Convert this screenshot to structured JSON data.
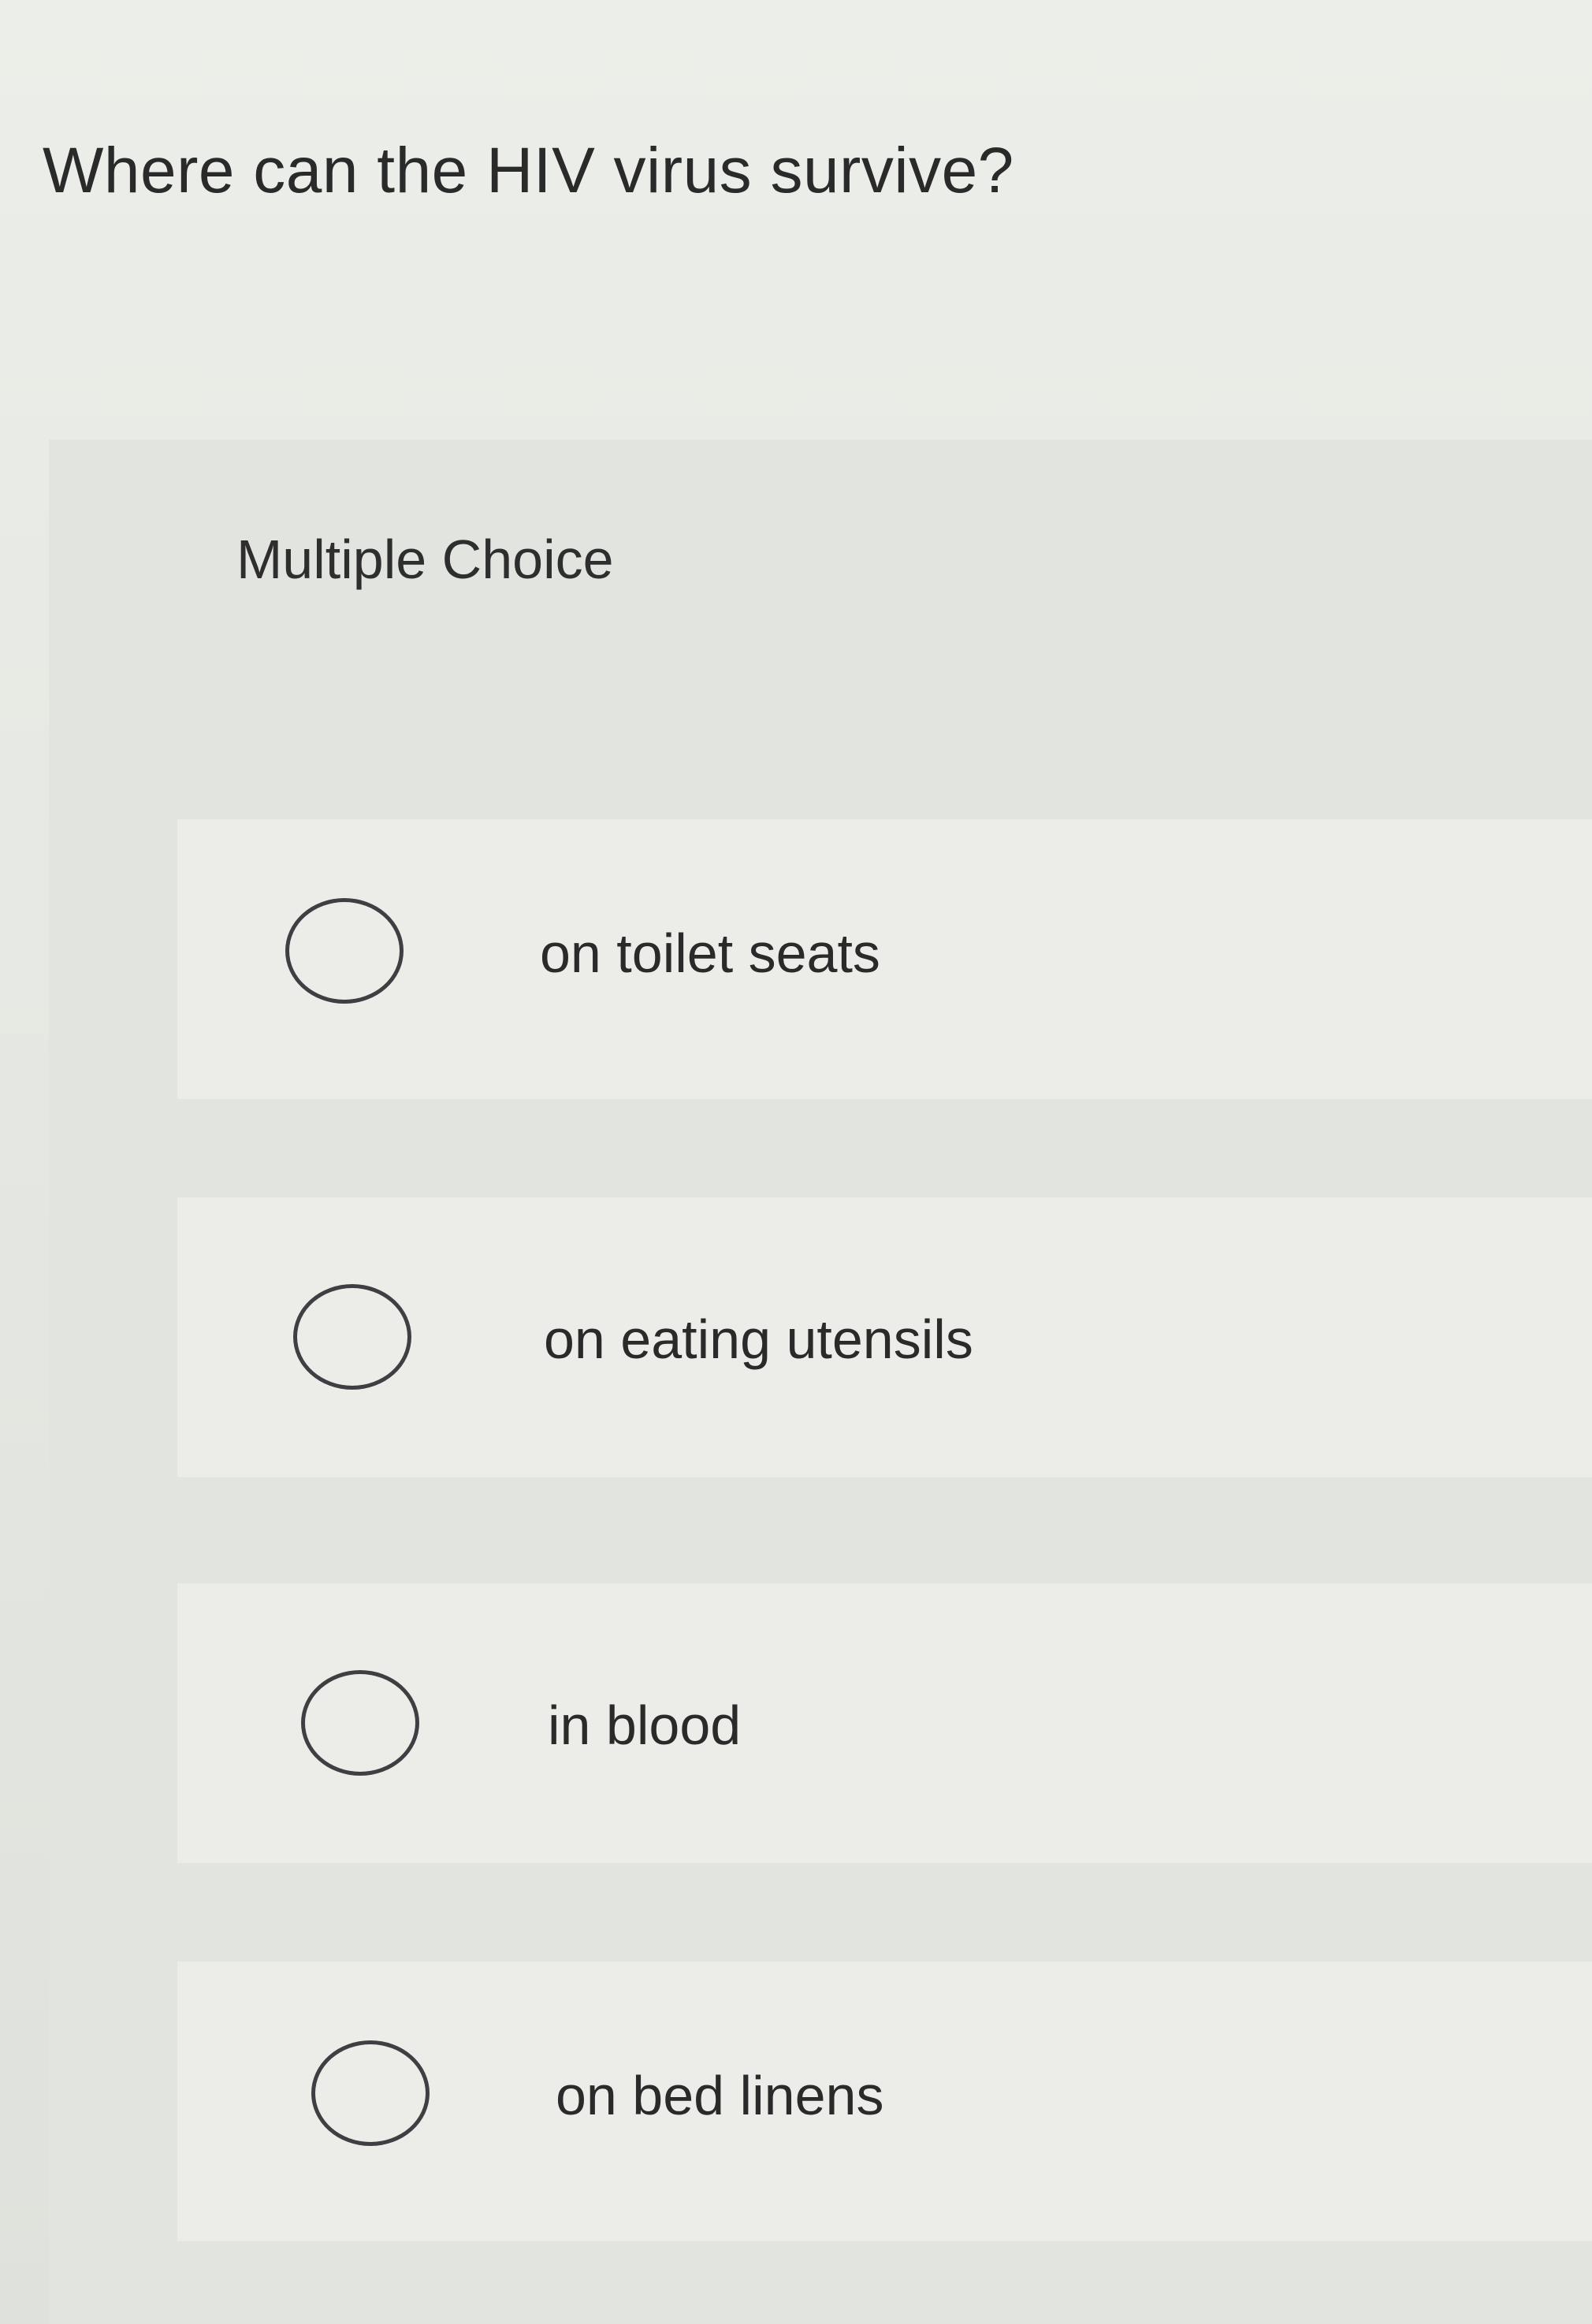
{
  "question": {
    "text": "Where can the HIV virus survive?"
  },
  "question_type": "Multiple Choice",
  "options": [
    {
      "label": "on toilet seats",
      "selected": false
    },
    {
      "label": "on eating utensils",
      "selected": false
    },
    {
      "label": "in blood",
      "selected": false
    },
    {
      "label": "on bed linens",
      "selected": false
    }
  ],
  "colors": {
    "background": "#e9ebe7",
    "panel": "#e2e4df",
    "option_row": "#ecede9",
    "text": "#2a2a2a",
    "radio_border": "#3d3f42"
  }
}
